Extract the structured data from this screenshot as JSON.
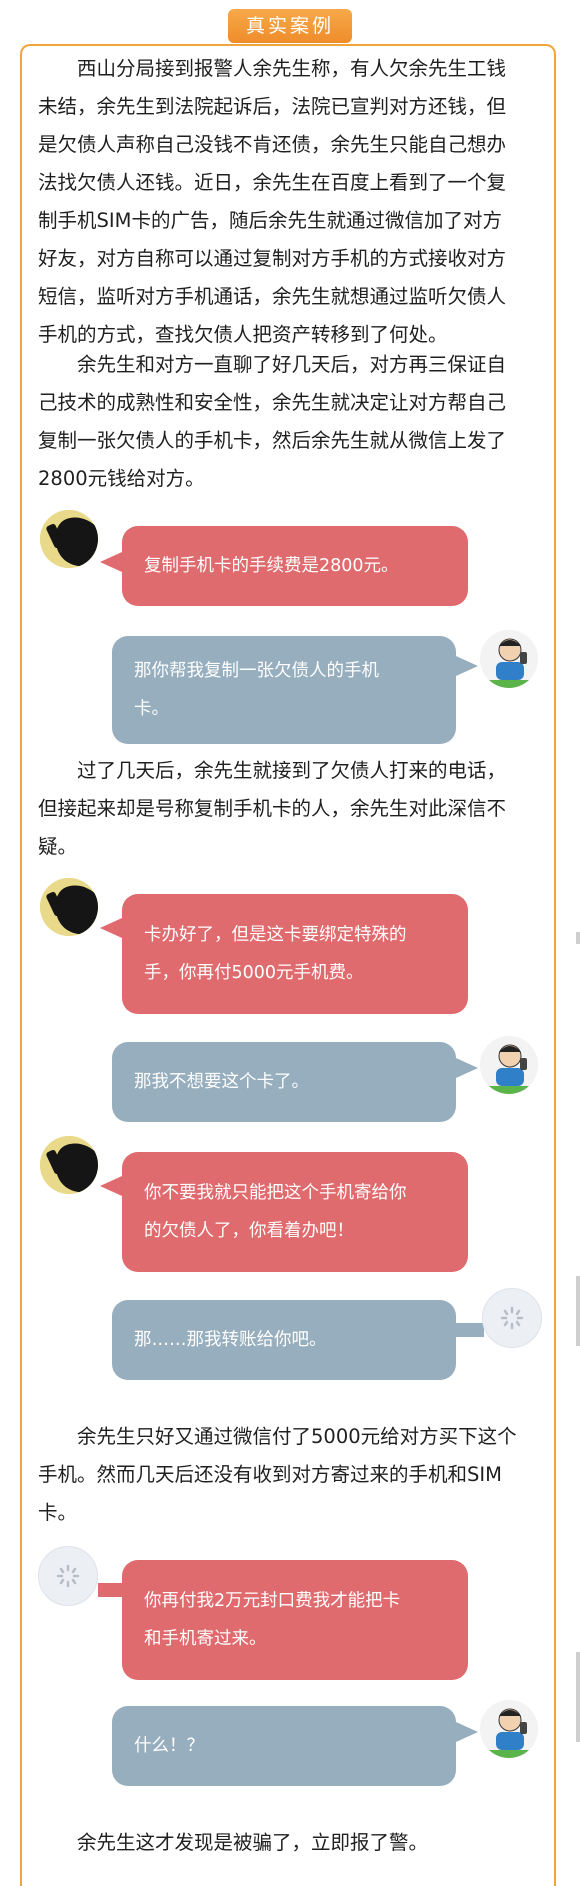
{
  "header": {
    "title": "真实案例"
  },
  "paragraphs": {
    "p1": [
      "西山分局接到报警人余先生称，有人欠余先生工钱",
      "未结，余先生到法院起诉后，法院已宣判对方还钱，但",
      "是欠债人声称自己没钱不肯还债，余先生只能自己想办",
      "法找欠债人还钱。近日，余先生在百度上看到了一个复",
      "制手机SIM卡的广告，随后余先生就通过微信加了对方",
      "好友，对方自称可以通过复制对方手机的方式接收对方",
      "短信，监听对方手机通话，余先生就想通过监听欠债人",
      "手机的方式，查找欠债人把资产转移到了何处。"
    ],
    "p2": [
      "余先生和对方一直聊了好几天后，对方再三保证自",
      "己技术的成熟性和安全性，余先生就决定让对方帮自己",
      "复制一张欠债人的手机卡，然后余先生就从微信上发了",
      "2800元钱给对方。"
    ],
    "p3": [
      "过了几天后，余先生就接到了欠债人打来的电话，",
      "但接起来却是号称复制手机卡的人，余先生对此深信不",
      "疑。"
    ],
    "p4": [
      "余先生只好又通过微信付了5000元给对方买下这个",
      "手机。然而几天后还没有收到对方寄过来的手机和SIM",
      "卡。"
    ],
    "p5": [
      "余先生这才发现是被骗了，立即报了警。"
    ]
  },
  "chat": {
    "m1": [
      "复制手机卡的手续费是2800元。"
    ],
    "m2": [
      "那你帮我复制一张欠债人的手机",
      "卡。"
    ],
    "m3": [
      "卡办好了，但是这卡要绑定特殊的",
      "手，你再付5000元手机费。"
    ],
    "m4": [
      "那我不想要这个卡了。"
    ],
    "m5": [
      "你不要我就只能把这个手机寄给你",
      "的欠债人了，你看着办吧！"
    ],
    "m6": [
      "那……那我转账给你吧。"
    ],
    "m7": [
      "你再付我2万元封口费我才能把卡",
      "和手机寄过来。"
    ],
    "m8": [
      "什么！？"
    ]
  },
  "colors": {
    "accent": "#f2a53b",
    "scammer_bubble": "#e06b6e",
    "victim_bubble": "#96aebe"
  },
  "icons": {
    "scammer_avatar": "phone-silhouette-avatar-icon",
    "victim_avatar": "cartoon-man-phone-avatar-icon",
    "loading_avatar": "loading-spinner-icon"
  }
}
